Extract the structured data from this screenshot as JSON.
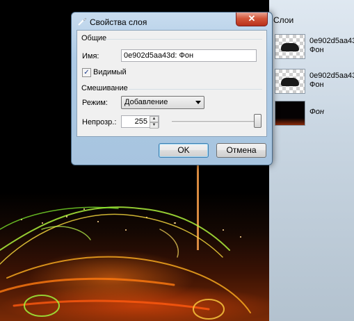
{
  "dialog": {
    "title": "Свойства слоя",
    "close_icon": "close-icon",
    "general_group": "Общие",
    "name_label": "Имя:",
    "name_value": "0e902d5aa43d: Фон",
    "visible_label": "Видимый",
    "visible_checked": true,
    "blending_group": "Смешивание",
    "mode_label": "Режим:",
    "mode_value": "Добавление",
    "opacity_label": "Непрозр.:",
    "opacity_value": "255",
    "opacity_level_fraction": 1.0,
    "ok_label": "OK",
    "cancel_label": "Отмена"
  },
  "layers_panel": {
    "title": "Слои",
    "items": [
      {
        "line1": "0e902d5aa43",
        "line2": "Фон"
      },
      {
        "line1": "0e902d5aa43",
        "line2": "Фон"
      },
      {
        "line1": "Фон",
        "line2": ""
      }
    ]
  },
  "colors": {
    "dialog_frame": "#a7c4df",
    "close_button": "#c8402a",
    "panel_bg": "#c9d6e2"
  }
}
